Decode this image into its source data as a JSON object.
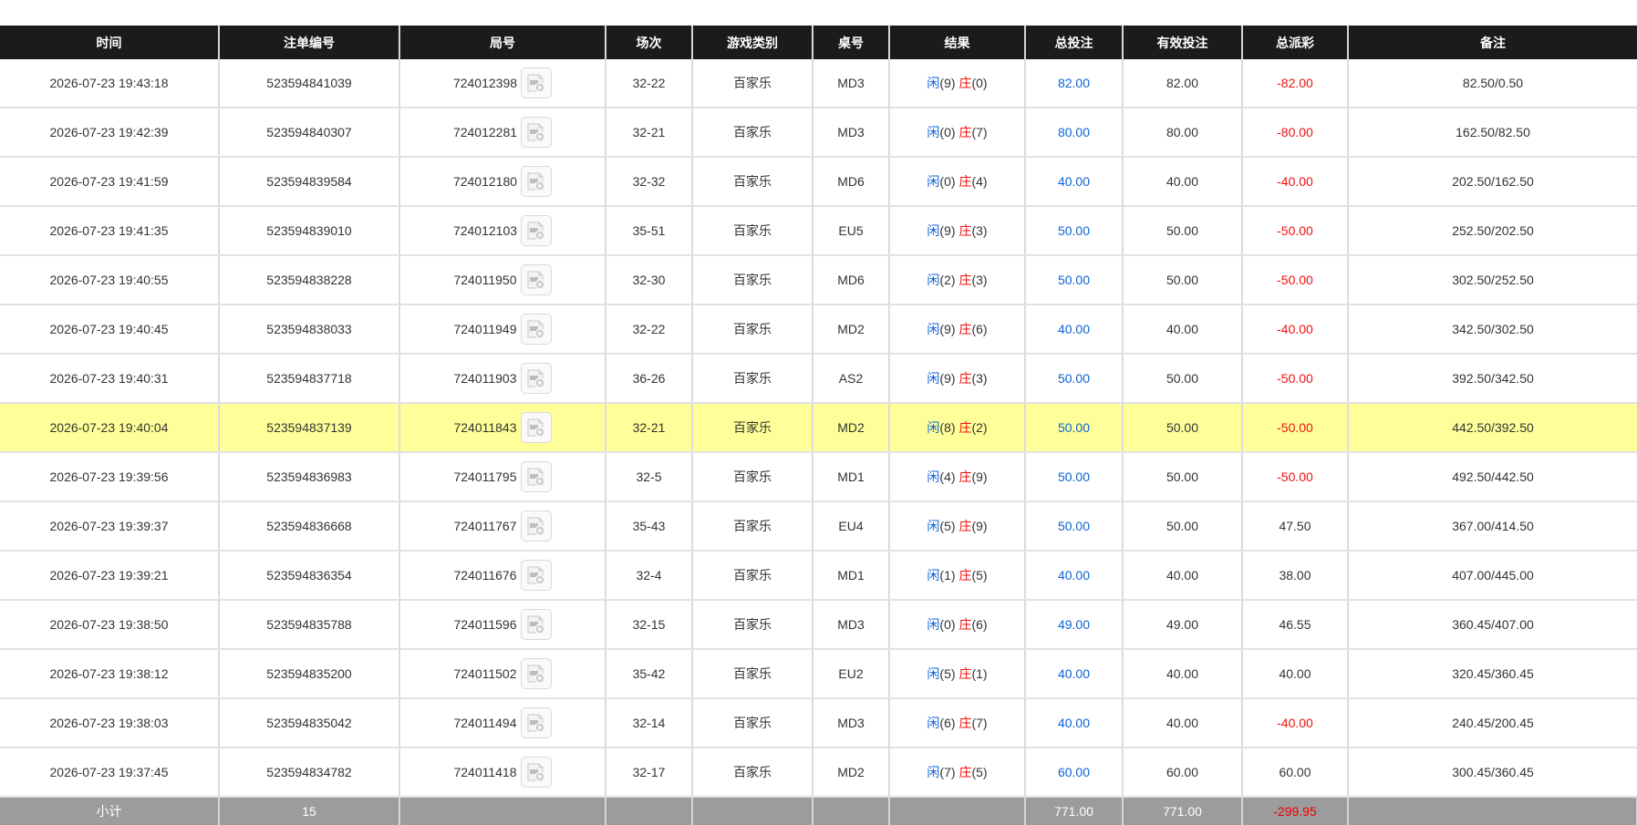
{
  "headers": [
    "时间",
    "注单编号",
    "局号",
    "场次",
    "游戏类别",
    "桌号",
    "结果",
    "总投注",
    "有效投注",
    "总派彩",
    "备注"
  ],
  "result_labels": {
    "player": "闲",
    "banker": "庄"
  },
  "colors": {
    "header_bg": "#1b1b1b",
    "highlight_row": "#ffff99",
    "blue_value": "#0d63d8",
    "negative_value": "#f01010",
    "subtotal_bg": "#9c9c9c"
  },
  "icon": "video-replay-icon",
  "highlighted_row_index": 7,
  "rows": [
    {
      "time": "2026-07-23 19:43:18",
      "bet_no": "523594841039",
      "round_no": "724012398",
      "session": "32-22",
      "game": "百家乐",
      "table": "MD3",
      "player_score": "9",
      "banker_score": "0",
      "total_bet": "82.00",
      "valid_bet": "82.00",
      "payout": "-82.00",
      "remark": "82.50/0.50"
    },
    {
      "time": "2026-07-23 19:42:39",
      "bet_no": "523594840307",
      "round_no": "724012281",
      "session": "32-21",
      "game": "百家乐",
      "table": "MD3",
      "player_score": "0",
      "banker_score": "7",
      "total_bet": "80.00",
      "valid_bet": "80.00",
      "payout": "-80.00",
      "remark": "162.50/82.50"
    },
    {
      "time": "2026-07-23 19:41:59",
      "bet_no": "523594839584",
      "round_no": "724012180",
      "session": "32-32",
      "game": "百家乐",
      "table": "MD6",
      "player_score": "0",
      "banker_score": "4",
      "total_bet": "40.00",
      "valid_bet": "40.00",
      "payout": "-40.00",
      "remark": "202.50/162.50"
    },
    {
      "time": "2026-07-23 19:41:35",
      "bet_no": "523594839010",
      "round_no": "724012103",
      "session": "35-51",
      "game": "百家乐",
      "table": "EU5",
      "player_score": "9",
      "banker_score": "3",
      "total_bet": "50.00",
      "valid_bet": "50.00",
      "payout": "-50.00",
      "remark": "252.50/202.50"
    },
    {
      "time": "2026-07-23 19:40:55",
      "bet_no": "523594838228",
      "round_no": "724011950",
      "session": "32-30",
      "game": "百家乐",
      "table": "MD6",
      "player_score": "2",
      "banker_score": "3",
      "total_bet": "50.00",
      "valid_bet": "50.00",
      "payout": "-50.00",
      "remark": "302.50/252.50"
    },
    {
      "time": "2026-07-23 19:40:45",
      "bet_no": "523594838033",
      "round_no": "724011949",
      "session": "32-22",
      "game": "百家乐",
      "table": "MD2",
      "player_score": "9",
      "banker_score": "6",
      "total_bet": "40.00",
      "valid_bet": "40.00",
      "payout": "-40.00",
      "remark": "342.50/302.50"
    },
    {
      "time": "2026-07-23 19:40:31",
      "bet_no": "523594837718",
      "round_no": "724011903",
      "session": "36-26",
      "game": "百家乐",
      "table": "AS2",
      "player_score": "9",
      "banker_score": "3",
      "total_bet": "50.00",
      "valid_bet": "50.00",
      "payout": "-50.00",
      "remark": "392.50/342.50"
    },
    {
      "time": "2026-07-23 19:40:04",
      "bet_no": "523594837139",
      "round_no": "724011843",
      "session": "32-21",
      "game": "百家乐",
      "table": "MD2",
      "player_score": "8",
      "banker_score": "2",
      "total_bet": "50.00",
      "valid_bet": "50.00",
      "payout": "-50.00",
      "remark": "442.50/392.50"
    },
    {
      "time": "2026-07-23 19:39:56",
      "bet_no": "523594836983",
      "round_no": "724011795",
      "session": "32-5",
      "game": "百家乐",
      "table": "MD1",
      "player_score": "4",
      "banker_score": "9",
      "total_bet": "50.00",
      "valid_bet": "50.00",
      "payout": "-50.00",
      "remark": "492.50/442.50"
    },
    {
      "time": "2026-07-23 19:39:37",
      "bet_no": "523594836668",
      "round_no": "724011767",
      "session": "35-43",
      "game": "百家乐",
      "table": "EU4",
      "player_score": "5",
      "banker_score": "9",
      "total_bet": "50.00",
      "valid_bet": "50.00",
      "payout": "47.50",
      "remark": "367.00/414.50"
    },
    {
      "time": "2026-07-23 19:39:21",
      "bet_no": "523594836354",
      "round_no": "724011676",
      "session": "32-4",
      "game": "百家乐",
      "table": "MD1",
      "player_score": "1",
      "banker_score": "5",
      "total_bet": "40.00",
      "valid_bet": "40.00",
      "payout": "38.00",
      "remark": "407.00/445.00"
    },
    {
      "time": "2026-07-23 19:38:50",
      "bet_no": "523594835788",
      "round_no": "724011596",
      "session": "32-15",
      "game": "百家乐",
      "table": "MD3",
      "player_score": "0",
      "banker_score": "6",
      "total_bet": "49.00",
      "valid_bet": "49.00",
      "payout": "46.55",
      "remark": "360.45/407.00"
    },
    {
      "time": "2026-07-23 19:38:12",
      "bet_no": "523594835200",
      "round_no": "724011502",
      "session": "35-42",
      "game": "百家乐",
      "table": "EU2",
      "player_score": "5",
      "banker_score": "1",
      "total_bet": "40.00",
      "valid_bet": "40.00",
      "payout": "40.00",
      "remark": "320.45/360.45"
    },
    {
      "time": "2026-07-23 19:38:03",
      "bet_no": "523594835042",
      "round_no": "724011494",
      "session": "32-14",
      "game": "百家乐",
      "table": "MD3",
      "player_score": "6",
      "banker_score": "7",
      "total_bet": "40.00",
      "valid_bet": "40.00",
      "payout": "-40.00",
      "remark": "240.45/200.45"
    },
    {
      "time": "2026-07-23 19:37:45",
      "bet_no": "523594834782",
      "round_no": "724011418",
      "session": "32-17",
      "game": "百家乐",
      "table": "MD2",
      "player_score": "7",
      "banker_score": "5",
      "total_bet": "60.00",
      "valid_bet": "60.00",
      "payout": "60.00",
      "remark": "300.45/360.45"
    }
  ],
  "subtotal": {
    "label": "小计",
    "count": "15",
    "total_bet": "771.00",
    "valid_bet": "771.00",
    "payout": "-299.95"
  }
}
